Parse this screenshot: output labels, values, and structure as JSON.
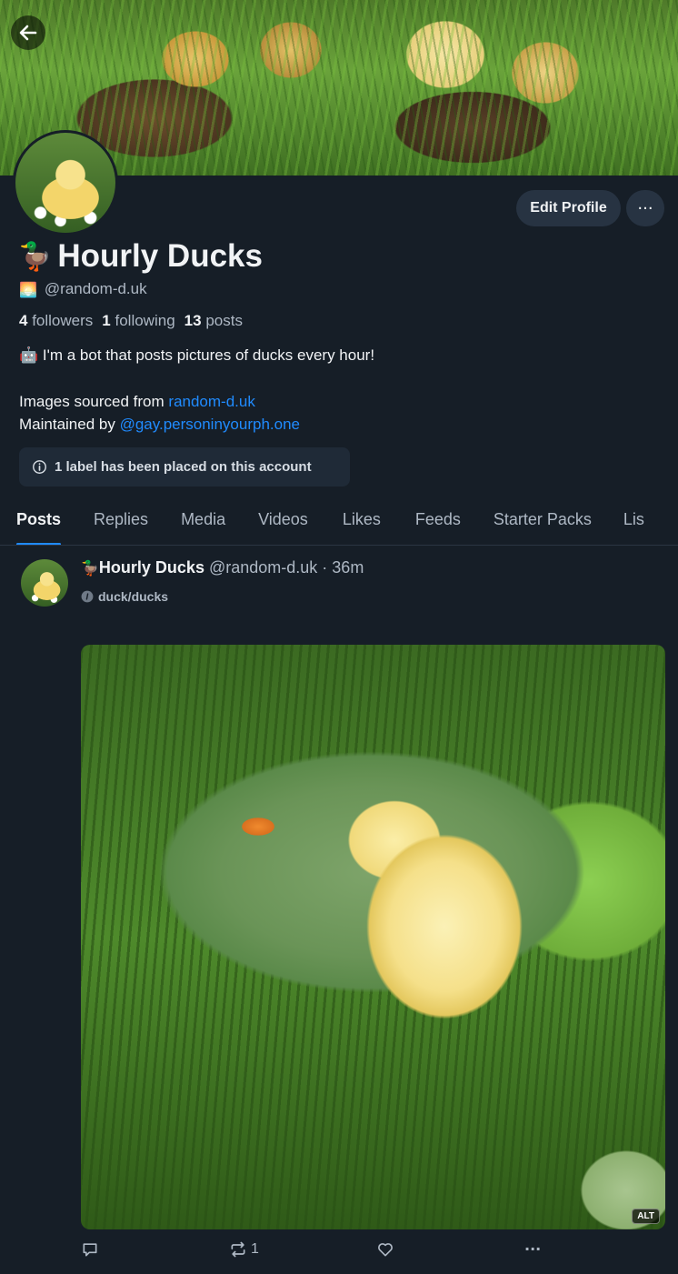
{
  "profile": {
    "display_name": "Hourly Ducks",
    "name_emoji": "🦆",
    "handle": "@random-d.uk",
    "handle_emoji": "🌅",
    "followers_count": "4",
    "followers_label": "followers",
    "following_count": "1",
    "following_label": "following",
    "posts_count": "13",
    "posts_label": "posts",
    "bio_line1_emoji": "🤖",
    "bio_line1": " I'm a bot that posts pictures of ducks every hour!",
    "bio_line2_prefix": "Images sourced from ",
    "bio_line2_link": "random-d.uk",
    "bio_line3_prefix": "Maintained by ",
    "bio_line3_link": "@gay.personinyourph.one",
    "label_notice": "1 label has been placed on this account",
    "edit_button": "Edit Profile",
    "more_button": "···"
  },
  "tabs": [
    "Posts",
    "Replies",
    "Media",
    "Videos",
    "Likes",
    "Feeds",
    "Starter Packs",
    "Lis"
  ],
  "post": {
    "author_emoji": "🦆",
    "author": "Hourly Ducks",
    "handle": "@random-d.uk",
    "separator": "·",
    "time": "36m",
    "label": "duck/ducks",
    "alt": "ALT",
    "repost_count": "1",
    "more": "···"
  },
  "colors": {
    "background": "#161e27",
    "accent": "#208bfe",
    "button_bg": "#273342",
    "muted_text": "#aeb8c4"
  },
  "icons": [
    "back-arrow-icon",
    "info-icon",
    "reply-icon",
    "repost-icon",
    "heart-icon",
    "more-icon"
  ]
}
